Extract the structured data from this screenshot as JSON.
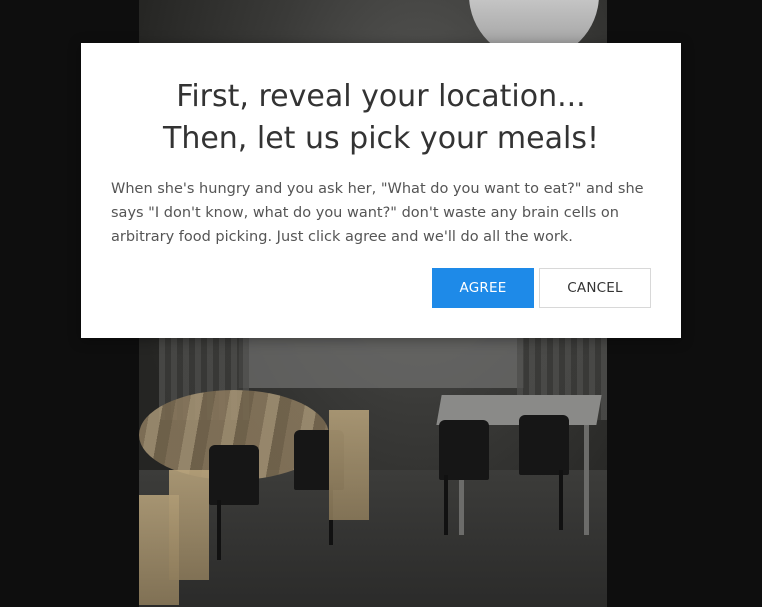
{
  "modal": {
    "title_line1": "First, reveal your location...",
    "title_line2": "Then, let us pick your meals!",
    "body": "When she's hungry and you ask her, \"What do you want to eat?\" and she says \"I don't know, what do you want?\" don't waste any brain cells on arbitrary food picking. Just click agree and we'll do all the work.",
    "agree_label": "AGREE",
    "cancel_label": "CANCEL"
  },
  "colors": {
    "agree_button": "#1e8ae8",
    "overlay_background": "#0e0e0e",
    "modal_background": "#ffffff"
  }
}
